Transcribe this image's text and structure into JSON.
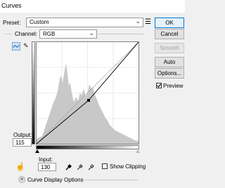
{
  "window": {
    "title": "Curves"
  },
  "preset": {
    "label": "Preset:",
    "value": "Custom"
  },
  "channel": {
    "label": "Channel:",
    "value": "RGB"
  },
  "buttons": {
    "ok": "OK",
    "cancel": "Cancel",
    "smooth": "Smooth",
    "auto": "Auto",
    "options": "Options...",
    "preview": "Preview"
  },
  "preview_checked": true,
  "output": {
    "label": "Output:",
    "value": "115"
  },
  "input": {
    "label": "Input:",
    "value": "130"
  },
  "show_clipping": {
    "label": "Show Clipping",
    "checked": false
  },
  "curve_display_options": "Curve Display Options",
  "icons": {
    "preset_menu": "preset-options-icon",
    "curve_tool": "curve-point-tool-icon",
    "pencil_tool": "pencil-tool-icon",
    "on_image_tool": "on-image-adjust-icon",
    "black_eyedropper": "black-point-eyedropper-icon",
    "gray_eyedropper": "gray-point-eyedropper-icon",
    "white_eyedropper": "white-point-eyedropper-icon",
    "expand": "expand-chevron-icon"
  },
  "colors": {
    "accent": "#0078d7",
    "histogram": "#c8c8c8",
    "curve": "#000000"
  }
}
